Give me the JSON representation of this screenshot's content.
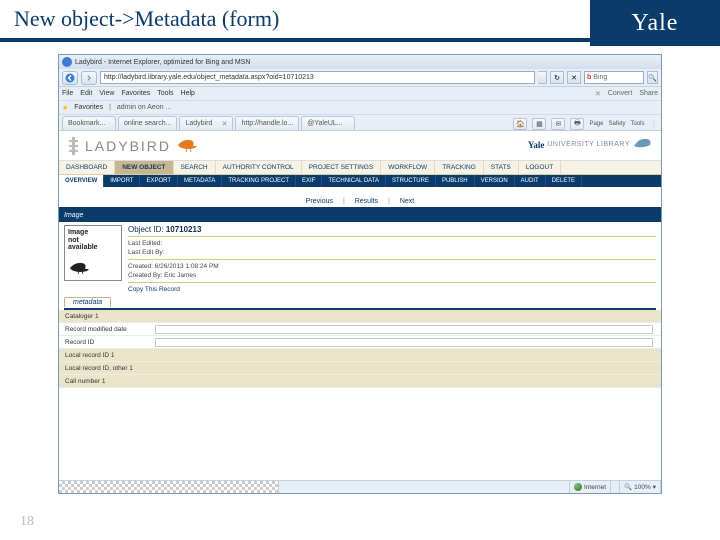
{
  "slide": {
    "title": "New object->Metadata (form)",
    "yale": "Yale",
    "number": "18"
  },
  "ie": {
    "title": "Ladybird - Internet Explorer, optimized for Bing and MSN",
    "url": "http://ladybird.library.yale.edu/object_metadata.aspx?oid=10710213",
    "search_placeholder": "Bing",
    "menu": {
      "file": "File",
      "edit": "Edit",
      "view": "View",
      "favorites": "Favorites",
      "tools": "Tools",
      "help": "Help",
      "share": "Share",
      "convert": "Convert"
    },
    "favbar": {
      "label": "Favorites",
      "rec": "admin on Aeon ..."
    },
    "tabs": [
      "Bookmark...",
      "online search...",
      "Ladybird",
      "http://handle.lo...",
      "@YaleUL..."
    ],
    "toolbar_right": [
      "Page",
      "Safety",
      "Tools"
    ],
    "status": {
      "internet": "Internet",
      "zoom": "100%"
    }
  },
  "app": {
    "brand": "LADYBIRD",
    "yul_yale": "Yale",
    "yul_label": "UNIVERSITY LIBRARY",
    "main_nav": [
      "DASHBOARD",
      "NEW OBJECT",
      "SEARCH",
      "AUTHORITY CONTROL",
      "PROJECT SETTINGS",
      "WORKFLOW",
      "TRACKING",
      "STATS",
      "LOGOUT"
    ],
    "sub_nav": [
      "OVERVIEW",
      "IMPORT",
      "EXPORT",
      "METADATA",
      "TRACKING PROJECT",
      "EXIF",
      "TECHNICAL DATA",
      "STRUCTURE",
      "PUBLISH",
      "VERSION",
      "AUDIT",
      "DELETE"
    ],
    "pager": {
      "prev": "Previous",
      "results": "Results",
      "next": "Next"
    },
    "image_bar": "Image",
    "thumb": {
      "line1": "Image",
      "line2": "not",
      "line3": "available"
    },
    "object": {
      "id_label": "Object ID:",
      "id_value": "10710213",
      "last_edited": "Last Edited:",
      "last_edit_by": "Last Edit By:",
      "created": "Created: 6/26/2013 1:08:24 PM",
      "created_by": "Created By: Eric James",
      "copy": "Copy This Record"
    },
    "meta_tab": "metadata",
    "fields": [
      {
        "label": "Cataloger 1",
        "band": true
      },
      {
        "label": "Record modified date",
        "band": false
      },
      {
        "label": "Record ID",
        "band": false
      },
      {
        "label": "Local record ID 1",
        "band": true
      },
      {
        "label": "Local record ID, other 1",
        "band": true
      },
      {
        "label": "Call number 1",
        "band": true
      }
    ]
  }
}
